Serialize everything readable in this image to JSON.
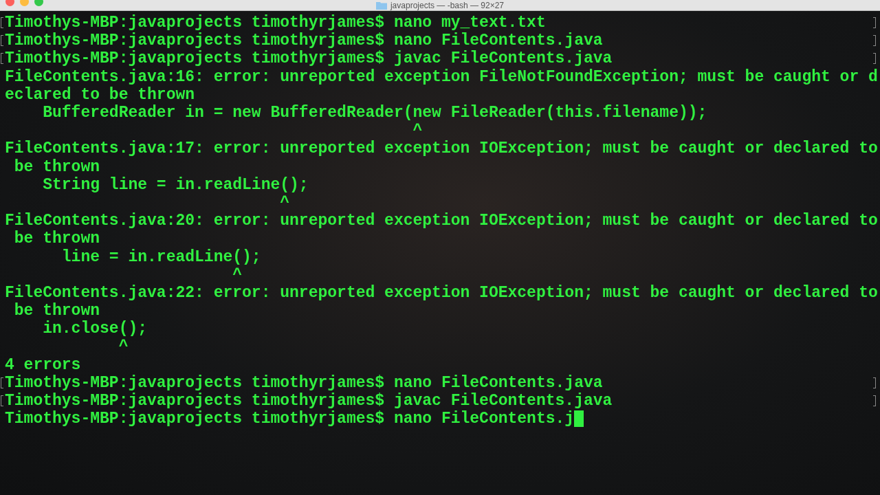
{
  "window": {
    "title": "javaprojects — -bash — 92×27",
    "controls": [
      {
        "color": "#fc605c"
      },
      {
        "color": "#fdbc40"
      },
      {
        "color": "#34c84a"
      }
    ]
  },
  "lines": [
    {
      "text": "Timothys-MBP:javaprojects timothyrjames$ nano my_text.txt",
      "marked": true,
      "cursor": false
    },
    {
      "text": "Timothys-MBP:javaprojects timothyrjames$ nano FileContents.java",
      "marked": true,
      "cursor": false
    },
    {
      "text": "Timothys-MBP:javaprojects timothyrjames$ javac FileContents.java",
      "marked": true,
      "cursor": false
    },
    {
      "text": "FileContents.java:16: error: unreported exception FileNotFoundException; must be caught or d",
      "marked": false,
      "cursor": false
    },
    {
      "text": "eclared to be thrown",
      "marked": false,
      "cursor": false
    },
    {
      "text": "    BufferedReader in = new BufferedReader(new FileReader(this.filename));",
      "marked": false,
      "cursor": false
    },
    {
      "text": "                                           ^",
      "marked": false,
      "cursor": false
    },
    {
      "text": "FileContents.java:17: error: unreported exception IOException; must be caught or declared to",
      "marked": false,
      "cursor": false
    },
    {
      "text": " be thrown",
      "marked": false,
      "cursor": false
    },
    {
      "text": "    String line = in.readLine();",
      "marked": false,
      "cursor": false
    },
    {
      "text": "                             ^",
      "marked": false,
      "cursor": false
    },
    {
      "text": "FileContents.java:20: error: unreported exception IOException; must be caught or declared to",
      "marked": false,
      "cursor": false
    },
    {
      "text": " be thrown",
      "marked": false,
      "cursor": false
    },
    {
      "text": "      line = in.readLine();",
      "marked": false,
      "cursor": false
    },
    {
      "text": "                        ^",
      "marked": false,
      "cursor": false
    },
    {
      "text": "FileContents.java:22: error: unreported exception IOException; must be caught or declared to",
      "marked": false,
      "cursor": false
    },
    {
      "text": " be thrown",
      "marked": false,
      "cursor": false
    },
    {
      "text": "    in.close();",
      "marked": false,
      "cursor": false
    },
    {
      "text": "            ^",
      "marked": false,
      "cursor": false
    },
    {
      "text": "4 errors",
      "marked": false,
      "cursor": false
    },
    {
      "text": "Timothys-MBP:javaprojects timothyrjames$ nano FileContents.java",
      "marked": true,
      "cursor": false
    },
    {
      "text": "Timothys-MBP:javaprojects timothyrjames$ javac FileContents.java",
      "marked": true,
      "cursor": false
    },
    {
      "text": "Timothys-MBP:javaprojects timothyrjames$ nano FileContents.j",
      "marked": false,
      "cursor": true
    }
  ]
}
